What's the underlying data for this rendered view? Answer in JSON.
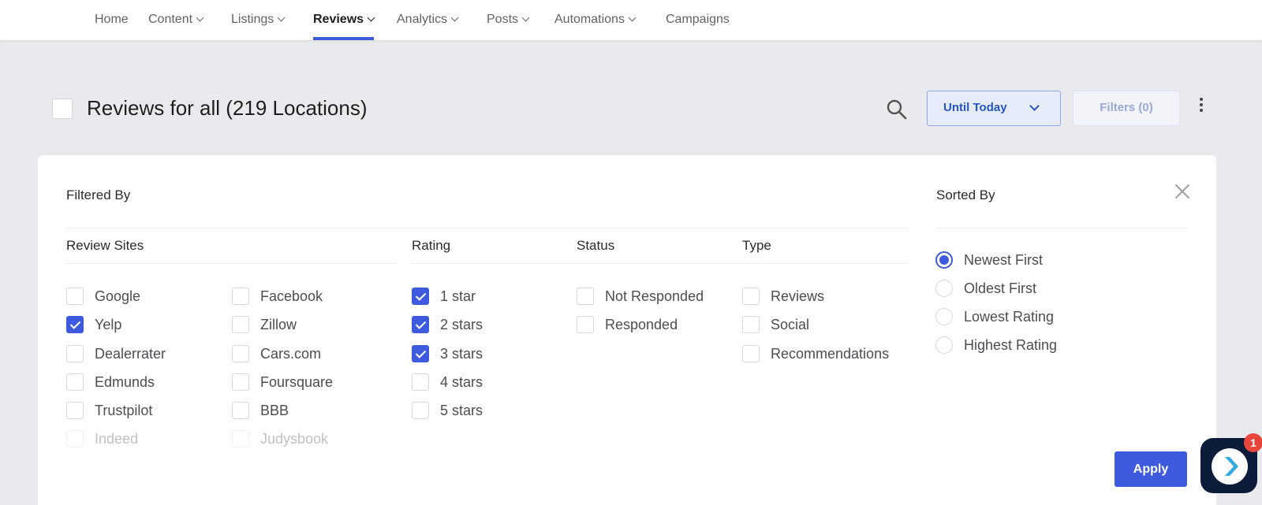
{
  "nav": {
    "items": [
      {
        "label": "Home",
        "dropdown": false,
        "active": false
      },
      {
        "label": "Content",
        "dropdown": true,
        "active": false
      },
      {
        "label": "Listings",
        "dropdown": true,
        "active": false
      },
      {
        "label": "Reviews",
        "dropdown": true,
        "active": true
      },
      {
        "label": "Analytics",
        "dropdown": true,
        "active": false
      },
      {
        "label": "Posts",
        "dropdown": true,
        "active": false
      },
      {
        "label": "Automations",
        "dropdown": true,
        "active": false
      },
      {
        "label": "Campaigns",
        "dropdown": false,
        "active": false
      }
    ]
  },
  "header": {
    "title": "Reviews for all (219 Locations)",
    "date_range_label": "Until Today",
    "filters_label": "Filters (0)"
  },
  "panel": {
    "filtered_by": "Filtered By",
    "sorted_by": "Sorted By",
    "columns": {
      "review_sites": "Review Sites",
      "rating": "Rating",
      "status": "Status",
      "type": "Type"
    },
    "review_sites": [
      {
        "label": "Google",
        "checked": false
      },
      {
        "label": "Facebook",
        "checked": false
      },
      {
        "label": "Yelp",
        "checked": true
      },
      {
        "label": "Zillow",
        "checked": false
      },
      {
        "label": "Dealerrater",
        "checked": false
      },
      {
        "label": "Cars.com",
        "checked": false
      },
      {
        "label": "Edmunds",
        "checked": false
      },
      {
        "label": "Foursquare",
        "checked": false
      },
      {
        "label": "Trustpilot",
        "checked": false
      },
      {
        "label": "BBB",
        "checked": false
      },
      {
        "label": "Indeed",
        "checked": false
      },
      {
        "label": "Judysbook",
        "checked": false
      }
    ],
    "rating": [
      {
        "label": "1 star",
        "checked": true
      },
      {
        "label": "2 stars",
        "checked": true
      },
      {
        "label": "3 stars",
        "checked": true
      },
      {
        "label": "4 stars",
        "checked": false
      },
      {
        "label": "5 stars",
        "checked": false
      }
    ],
    "status": [
      {
        "label": "Not Responded",
        "checked": false
      },
      {
        "label": "Responded",
        "checked": false
      }
    ],
    "type": [
      {
        "label": "Reviews",
        "checked": false
      },
      {
        "label": "Social",
        "checked": false
      },
      {
        "label": "Recommendations",
        "checked": false
      }
    ],
    "sort_options": [
      {
        "label": "Newest First",
        "selected": true
      },
      {
        "label": "Oldest First",
        "selected": false
      },
      {
        "label": "Lowest Rating",
        "selected": false
      },
      {
        "label": "Highest Rating",
        "selected": false
      }
    ],
    "apply_label": "Apply"
  },
  "chat": {
    "badge_count": "1"
  },
  "colors": {
    "accent": "#3e5be0",
    "background": "#e9eaed",
    "badge": "#e8463a",
    "chat_bg": "#0d1c3a"
  }
}
